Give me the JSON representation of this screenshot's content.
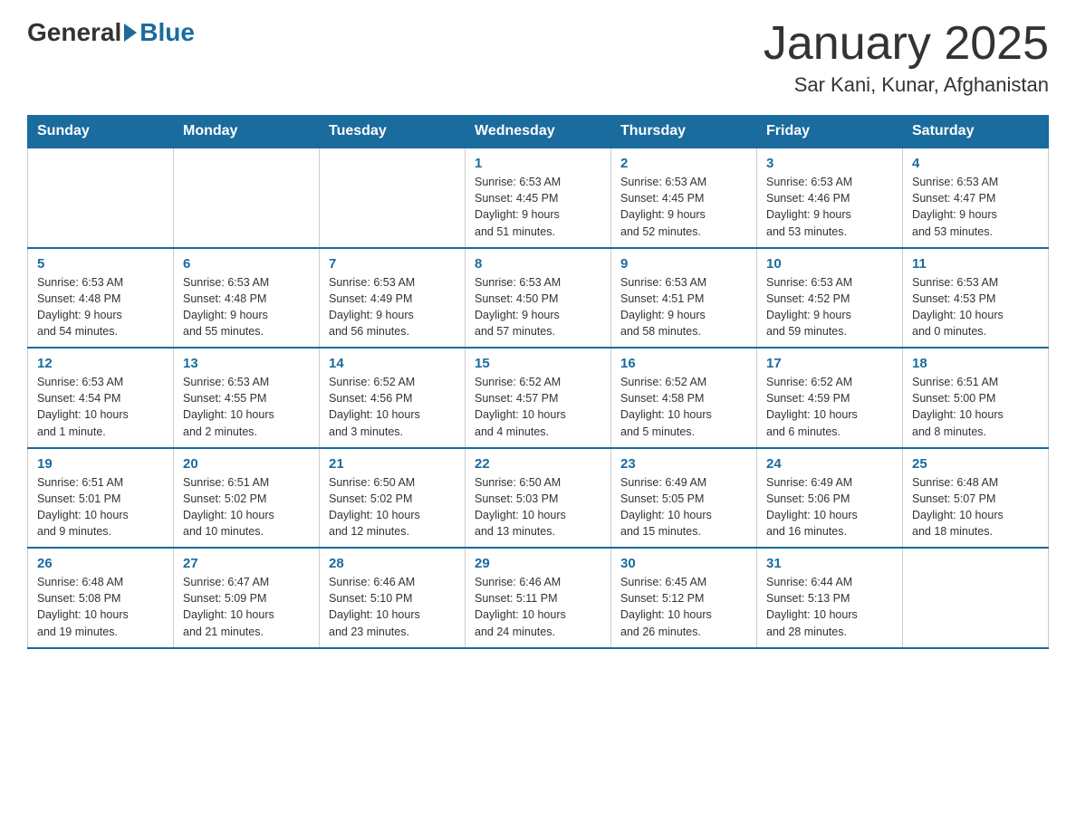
{
  "header": {
    "logo_general": "General",
    "logo_blue": "Blue",
    "title": "January 2025",
    "subtitle": "Sar Kani, Kunar, Afghanistan"
  },
  "weekdays": [
    "Sunday",
    "Monday",
    "Tuesday",
    "Wednesday",
    "Thursday",
    "Friday",
    "Saturday"
  ],
  "weeks": [
    [
      {
        "day": "",
        "info": ""
      },
      {
        "day": "",
        "info": ""
      },
      {
        "day": "",
        "info": ""
      },
      {
        "day": "1",
        "info": "Sunrise: 6:53 AM\nSunset: 4:45 PM\nDaylight: 9 hours\nand 51 minutes."
      },
      {
        "day": "2",
        "info": "Sunrise: 6:53 AM\nSunset: 4:45 PM\nDaylight: 9 hours\nand 52 minutes."
      },
      {
        "day": "3",
        "info": "Sunrise: 6:53 AM\nSunset: 4:46 PM\nDaylight: 9 hours\nand 53 minutes."
      },
      {
        "day": "4",
        "info": "Sunrise: 6:53 AM\nSunset: 4:47 PM\nDaylight: 9 hours\nand 53 minutes."
      }
    ],
    [
      {
        "day": "5",
        "info": "Sunrise: 6:53 AM\nSunset: 4:48 PM\nDaylight: 9 hours\nand 54 minutes."
      },
      {
        "day": "6",
        "info": "Sunrise: 6:53 AM\nSunset: 4:48 PM\nDaylight: 9 hours\nand 55 minutes."
      },
      {
        "day": "7",
        "info": "Sunrise: 6:53 AM\nSunset: 4:49 PM\nDaylight: 9 hours\nand 56 minutes."
      },
      {
        "day": "8",
        "info": "Sunrise: 6:53 AM\nSunset: 4:50 PM\nDaylight: 9 hours\nand 57 minutes."
      },
      {
        "day": "9",
        "info": "Sunrise: 6:53 AM\nSunset: 4:51 PM\nDaylight: 9 hours\nand 58 minutes."
      },
      {
        "day": "10",
        "info": "Sunrise: 6:53 AM\nSunset: 4:52 PM\nDaylight: 9 hours\nand 59 minutes."
      },
      {
        "day": "11",
        "info": "Sunrise: 6:53 AM\nSunset: 4:53 PM\nDaylight: 10 hours\nand 0 minutes."
      }
    ],
    [
      {
        "day": "12",
        "info": "Sunrise: 6:53 AM\nSunset: 4:54 PM\nDaylight: 10 hours\nand 1 minute."
      },
      {
        "day": "13",
        "info": "Sunrise: 6:53 AM\nSunset: 4:55 PM\nDaylight: 10 hours\nand 2 minutes."
      },
      {
        "day": "14",
        "info": "Sunrise: 6:52 AM\nSunset: 4:56 PM\nDaylight: 10 hours\nand 3 minutes."
      },
      {
        "day": "15",
        "info": "Sunrise: 6:52 AM\nSunset: 4:57 PM\nDaylight: 10 hours\nand 4 minutes."
      },
      {
        "day": "16",
        "info": "Sunrise: 6:52 AM\nSunset: 4:58 PM\nDaylight: 10 hours\nand 5 minutes."
      },
      {
        "day": "17",
        "info": "Sunrise: 6:52 AM\nSunset: 4:59 PM\nDaylight: 10 hours\nand 6 minutes."
      },
      {
        "day": "18",
        "info": "Sunrise: 6:51 AM\nSunset: 5:00 PM\nDaylight: 10 hours\nand 8 minutes."
      }
    ],
    [
      {
        "day": "19",
        "info": "Sunrise: 6:51 AM\nSunset: 5:01 PM\nDaylight: 10 hours\nand 9 minutes."
      },
      {
        "day": "20",
        "info": "Sunrise: 6:51 AM\nSunset: 5:02 PM\nDaylight: 10 hours\nand 10 minutes."
      },
      {
        "day": "21",
        "info": "Sunrise: 6:50 AM\nSunset: 5:02 PM\nDaylight: 10 hours\nand 12 minutes."
      },
      {
        "day": "22",
        "info": "Sunrise: 6:50 AM\nSunset: 5:03 PM\nDaylight: 10 hours\nand 13 minutes."
      },
      {
        "day": "23",
        "info": "Sunrise: 6:49 AM\nSunset: 5:05 PM\nDaylight: 10 hours\nand 15 minutes."
      },
      {
        "day": "24",
        "info": "Sunrise: 6:49 AM\nSunset: 5:06 PM\nDaylight: 10 hours\nand 16 minutes."
      },
      {
        "day": "25",
        "info": "Sunrise: 6:48 AM\nSunset: 5:07 PM\nDaylight: 10 hours\nand 18 minutes."
      }
    ],
    [
      {
        "day": "26",
        "info": "Sunrise: 6:48 AM\nSunset: 5:08 PM\nDaylight: 10 hours\nand 19 minutes."
      },
      {
        "day": "27",
        "info": "Sunrise: 6:47 AM\nSunset: 5:09 PM\nDaylight: 10 hours\nand 21 minutes."
      },
      {
        "day": "28",
        "info": "Sunrise: 6:46 AM\nSunset: 5:10 PM\nDaylight: 10 hours\nand 23 minutes."
      },
      {
        "day": "29",
        "info": "Sunrise: 6:46 AM\nSunset: 5:11 PM\nDaylight: 10 hours\nand 24 minutes."
      },
      {
        "day": "30",
        "info": "Sunrise: 6:45 AM\nSunset: 5:12 PM\nDaylight: 10 hours\nand 26 minutes."
      },
      {
        "day": "31",
        "info": "Sunrise: 6:44 AM\nSunset: 5:13 PM\nDaylight: 10 hours\nand 28 minutes."
      },
      {
        "day": "",
        "info": ""
      }
    ]
  ]
}
